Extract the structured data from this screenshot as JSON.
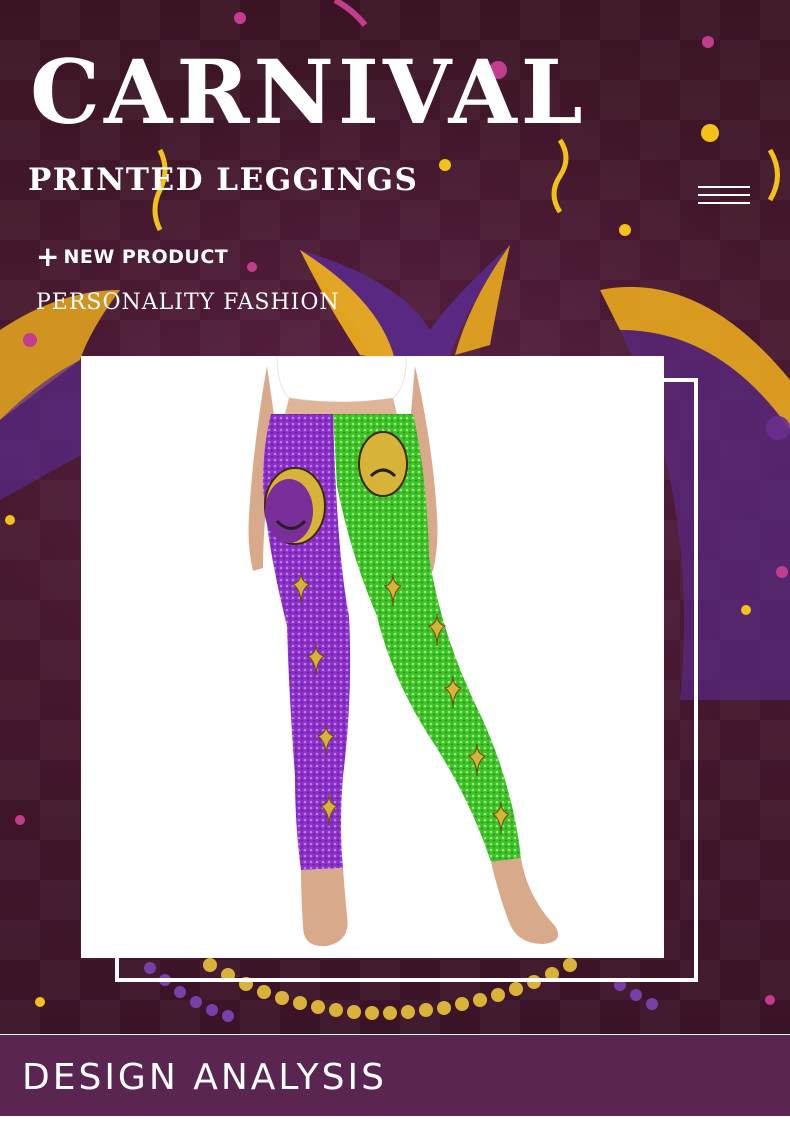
{
  "header": {
    "title": "CARNIVAL",
    "subtitle": "PRINTED LEGGINGS",
    "menu_icon": "hamburger-menu-icon"
  },
  "tagline": {
    "plus_symbol": "+",
    "new_product": "NEW PRODUCT",
    "fashion": "PERSONALITY FASHION"
  },
  "product_image": {
    "icon": "leggings-photo",
    "description_colors": {
      "left_leg": "#8a2fc8",
      "right_leg": "#3fbf2a",
      "accent_gold": "#d7b33a"
    }
  },
  "section": {
    "title": "DESIGN ANALYSIS"
  },
  "colors": {
    "background": "#3b1327",
    "jester_purple": "#5a2a8a",
    "jester_gold": "#f2b21c",
    "band": "#5a2550"
  }
}
